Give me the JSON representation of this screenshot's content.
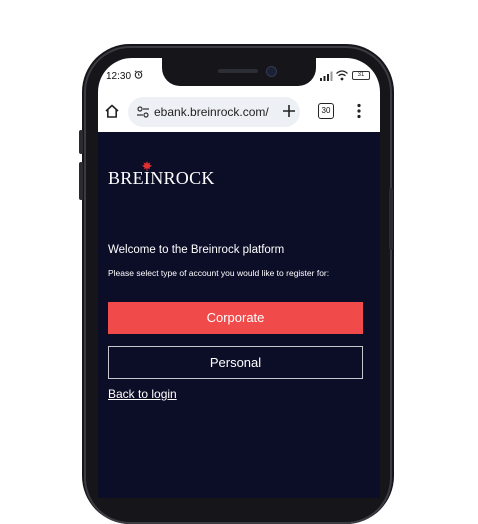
{
  "status_bar": {
    "time": "12:30",
    "battery_level": "31"
  },
  "browser": {
    "url": "ebank.breinrock.com/",
    "tab_count": "30"
  },
  "page": {
    "logo_text": "BREINROCK",
    "welcome": "Welcome to the Breinrock platform",
    "instruction": "Please select type of account you would like to register for:",
    "corporate_label": "Corporate",
    "personal_label": "Personal",
    "back_label": "Back to login"
  },
  "colors": {
    "page_background": "#0c0e28",
    "accent_red": "#f04a4a",
    "text_white": "#ffffff"
  },
  "icons": [
    "alarm-icon",
    "signal-icon",
    "wifi-icon",
    "battery-icon",
    "home-icon",
    "site-settings-icon",
    "new-tab-icon",
    "tabs-icon",
    "menu-icon",
    "maple-leaf-icon"
  ]
}
